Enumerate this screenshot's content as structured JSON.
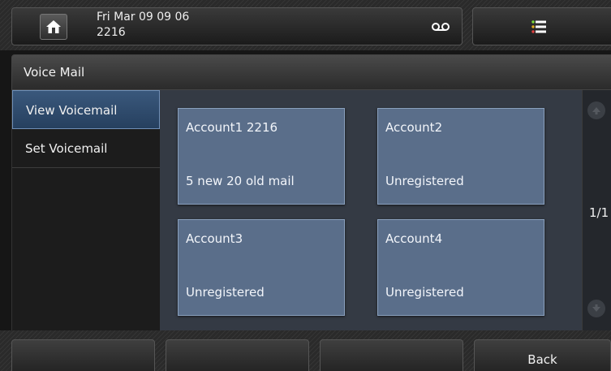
{
  "status_bar": {
    "date": "Fri Mar 09 09 06",
    "extension": "2216",
    "icons": {
      "home": "home-icon",
      "voicemail": "voicemail-icon",
      "menu": "menu-list-icon"
    }
  },
  "title": "Voice Mail",
  "sidebar": {
    "items": [
      {
        "label": "View Voicemail",
        "active": true
      },
      {
        "label": "Set Voicemail",
        "active": false
      }
    ]
  },
  "accounts": [
    {
      "name": "Account1 2216",
      "status": "5 new 20 old mail"
    },
    {
      "name": "Account2",
      "status": "Unregistered"
    },
    {
      "name": "Account3",
      "status": "Unregistered"
    },
    {
      "name": "Account4",
      "status": "Unregistered"
    }
  ],
  "pager": {
    "label": "1/1"
  },
  "softkeys": [
    "",
    "",
    "",
    "Back"
  ],
  "colors": {
    "card": "#5a6e8a",
    "active_item": "#3a587c",
    "content_bg": "#343a44",
    "menu_icon_green": "#7ddc3a"
  }
}
